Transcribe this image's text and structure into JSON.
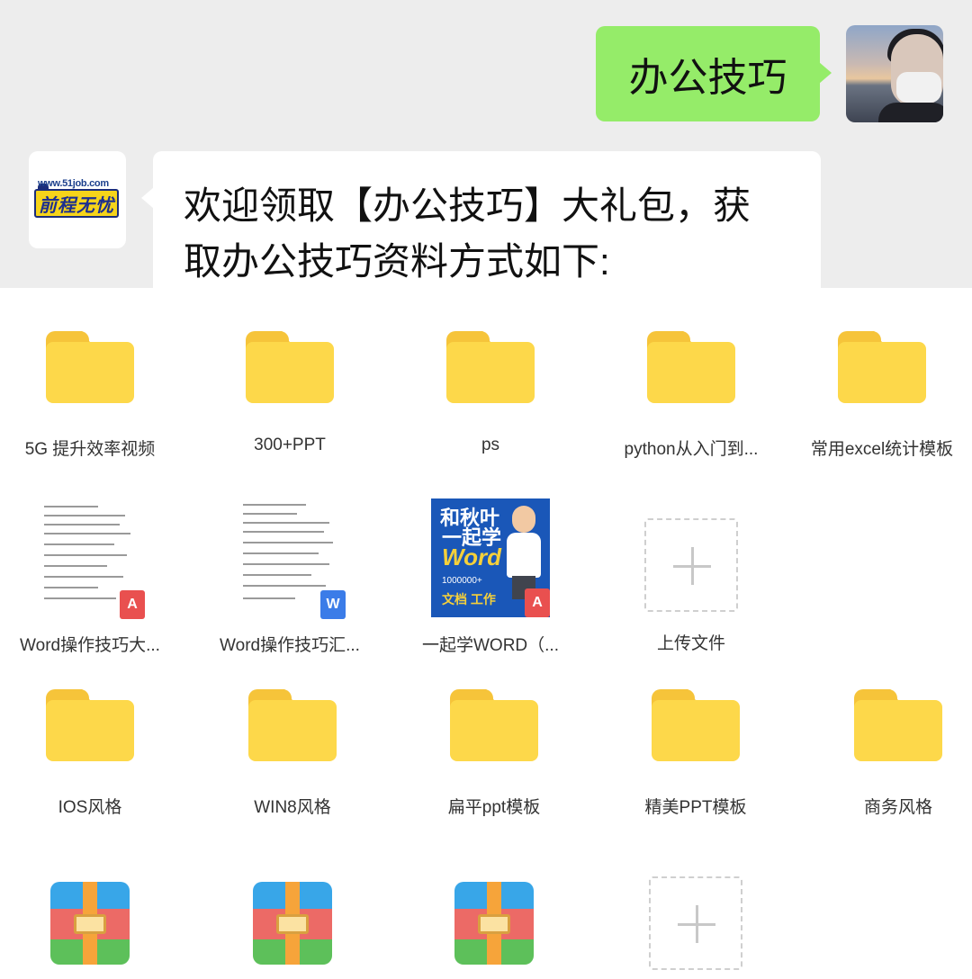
{
  "chat": {
    "outgoing_message": "办公技巧",
    "incoming_message_line1": "欢迎领取【办公技巧】大礼包，获",
    "incoming_message_line2": "取办公技巧资料方式如下:",
    "bot_avatar": {
      "url_text": "www.51job.com",
      "brand_text": "前程无忧"
    }
  },
  "files": {
    "row1": [
      "5G 提升效率视频",
      "300+PPT",
      "ps",
      "python从入门到...",
      "常用excel统计模板"
    ],
    "row2": [
      "Word操作技巧大...",
      "Word操作技巧汇...",
      "一起学WORD（...",
      "上传文件"
    ],
    "row3": [
      "IOS风格",
      "WIN8风格",
      "扁平ppt模板",
      "精美PPT模板",
      "商务风格"
    ],
    "cover": {
      "line1": "和秋叶",
      "line2": "一起学",
      "line3": "Word",
      "line4": "1000000+",
      "line5": "文档 工作"
    },
    "badges": {
      "pdf": "A",
      "word": "W"
    }
  },
  "colors": {
    "out_bubble": "#95ec69",
    "chat_bg": "#ededed",
    "folder": "#fdd84a"
  }
}
